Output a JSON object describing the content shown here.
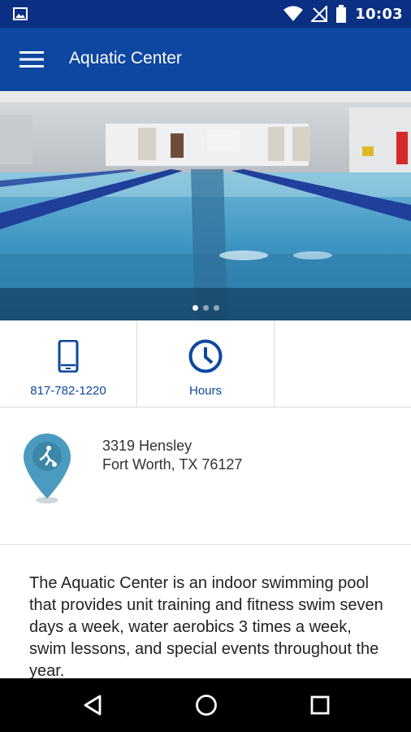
{
  "status_bar": {
    "time": "10:03"
  },
  "app_bar": {
    "title": "Aquatic Center"
  },
  "hero": {
    "slide_count": 3,
    "active_slide": 1
  },
  "actions": [
    {
      "label": "817-782-1220",
      "icon": "phone-icon"
    },
    {
      "label": "Hours",
      "icon": "clock-icon"
    }
  ],
  "address": {
    "line1": "3319 Hensley",
    "line2": "Fort Worth, TX 76127",
    "icon": "location-pin-icon"
  },
  "description": "The Aquatic Center is an indoor swimming pool that provides unit training and fitness swim seven days a week, water aerobics 3 times a week, swim lessons, and special events throughout the year.",
  "colors": {
    "status_bar": "#0b2f82",
    "app_bar": "#0d47a1",
    "accent": "#0d47a1",
    "pin": "#4a9bbf"
  }
}
